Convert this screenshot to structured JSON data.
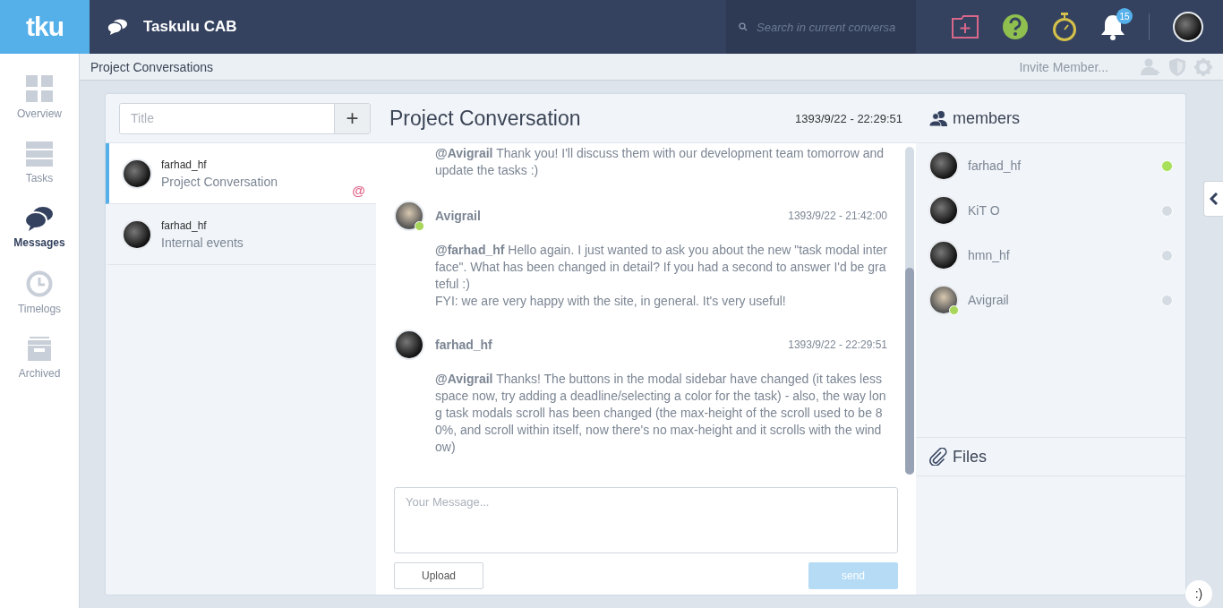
{
  "app": {
    "logo": "tku",
    "workspace": "Taskulu CAB",
    "search": {
      "placeholder": "Search in current conversa"
    },
    "notifications": "15"
  },
  "nav": [
    {
      "label": "Overview",
      "kind": "grid",
      "selected": false
    },
    {
      "label": "Tasks",
      "kind": "tasks",
      "selected": false
    },
    {
      "label": "Messages",
      "kind": "chat",
      "selected": true
    },
    {
      "label": "Timelogs",
      "kind": "clock",
      "selected": false
    },
    {
      "label": "Archived",
      "kind": "archive",
      "selected": false
    }
  ],
  "subheader": {
    "title": "Project Conversations",
    "invite": "Invite Member..."
  },
  "conversations": {
    "title_field": {
      "placeholder": "Title"
    },
    "add": "+",
    "items": [
      {
        "author": "farhad_hf",
        "title": "Project Conversation",
        "selected": true,
        "mention": "@"
      },
      {
        "author": "farhad_hf",
        "title": "Internal events",
        "selected": false
      }
    ]
  },
  "chat": {
    "title": "Project Conversation",
    "date": "1393/9/22 - 22:29:51",
    "messages": [
      {
        "kind": "continued",
        "mention": "@Avigrail",
        "text": "Thank you! I'll discuss them with our development team tomorrow and update the tasks :)"
      },
      {
        "kind": "full",
        "author": "Avigrail",
        "badge": true,
        "time": "1393/9/22 - 21:42:00",
        "mention": "@farhad_hf",
        "text": "Hello again. I just wanted to ask you about the new \"task modal interface\". What has been changed in detail? If you had a second to answer I'd be grateful :)\nFYI: we are very happy with the site, in general. It's very useful!"
      },
      {
        "kind": "full",
        "author": "farhad_hf",
        "badge": false,
        "time": "1393/9/22 - 22:29:51",
        "mention": "@Avigrail",
        "text": "Thanks! The buttons in the modal sidebar have changed (it takes less space now, try adding a deadline/selecting a color for the task) - also, the way long task modals scroll has been changed (the max-height of the scroll used to be 80%, and scroll within itself, now there's no max-height and it scrolls with the window)"
      }
    ],
    "composer": {
      "placeholder": "Your Message...",
      "upload": "Upload",
      "send": "send",
      "send_disabled": true
    }
  },
  "members": {
    "title": "members",
    "items": [
      {
        "name": "farhad_hf",
        "online": true,
        "badge": false
      },
      {
        "name": "KiT O",
        "online": false,
        "badge": false
      },
      {
        "name": "hmn_hf",
        "online": false,
        "badge": false
      },
      {
        "name": "Avigrail",
        "online": false,
        "badge": true
      }
    ]
  },
  "files": {
    "title": "Files"
  },
  "smiley": ":)"
}
